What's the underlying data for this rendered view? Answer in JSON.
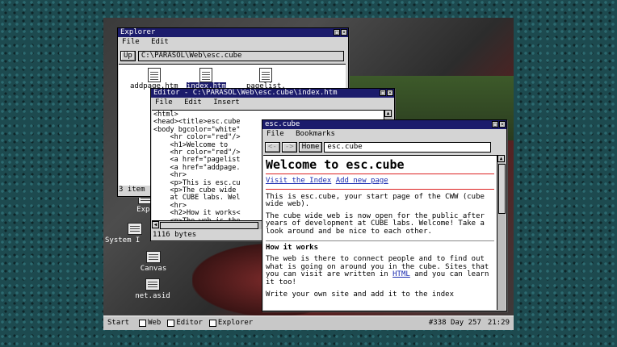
{
  "explorer": {
    "title": "Explorer",
    "menu": [
      "File",
      "Edit"
    ],
    "up_label": "Up",
    "path": "C:\\PARASOL\\Web\\esc.cube",
    "files": [
      "addpage.htm",
      "index.htm",
      "pagelist."
    ],
    "status": "3 item"
  },
  "editor": {
    "title": "Editor - C:\\PARASOL\\Web\\esc.cube\\index.htm",
    "menu": [
      "File",
      "Edit",
      "Insert"
    ],
    "code": "<html>\n<head><title>esc.cube\n<body bgcolor=\"white\"\n    <hr color=\"red\"/>\n    <h1>Welcome to\n    <hr color=\"red\"/>\n    <a href=\"pagelist\n    <a href=\"addpage.\n    <hr>\n    <p>This is esc.cu\n    <p>The cube wide\n    at CUBE labs. Wel\n    <hr>\n    <h2>How it works<\n    <p>The web is the",
    "status": "1116 bytes"
  },
  "browser": {
    "title": "esc.cube",
    "menu": [
      "File",
      "Bookmarks"
    ],
    "back": "<-",
    "forward": "->",
    "home_label": "Home",
    "address": "esc.cube",
    "heading": "Welcome to esc.cube",
    "link_index": "Visit the Index",
    "link_add": "Add new page",
    "para1": "This is esc.cube, your start page of the CWW (cube wide web).",
    "para2": "The cube wide web is now open for the public after years of development at CUBE labs. Welcome! Take a look around and be nice to each other.",
    "h2": "How it works",
    "para3_a": "The web is there to connect people and to find out what is going on around you in the cube. Sites that you can visit are written in ",
    "para3_link": "HTML",
    "para3_b": " and you can learn it too!",
    "para4": "Write your own site and add it to the index"
  },
  "desktop_icons": [
    "Expl",
    "System I",
    "Canvas",
    "net.asid"
  ],
  "taskbar": {
    "start": "Start",
    "items": [
      "Web",
      "Editor",
      "Explorer"
    ],
    "info": "#338 Day 257",
    "time": "21:29"
  }
}
